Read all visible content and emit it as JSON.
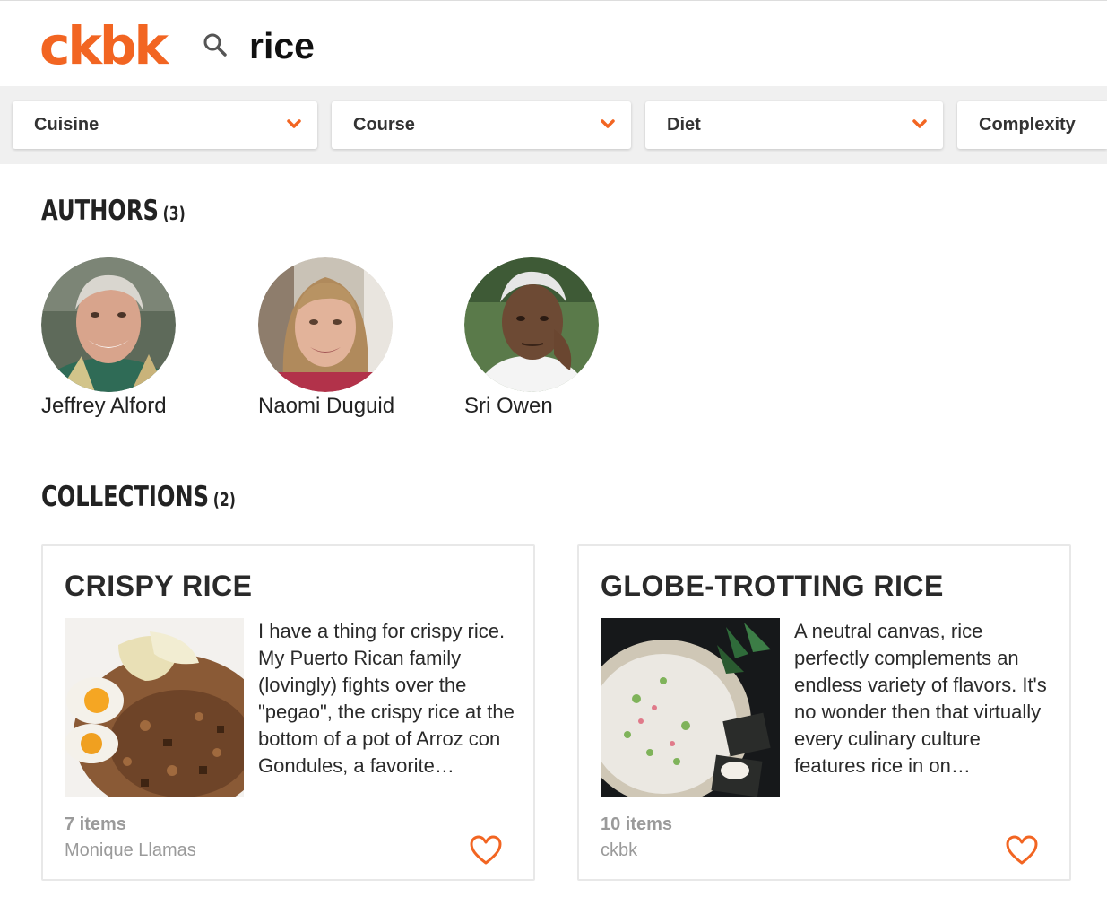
{
  "header": {
    "logo_text": "ckbk",
    "search_icon": "search-icon",
    "search_value": "rice",
    "brand_color": "#f26522"
  },
  "filters": [
    {
      "label": "Cuisine",
      "icon": "chevron-down-icon"
    },
    {
      "label": "Course",
      "icon": "chevron-down-icon"
    },
    {
      "label": "Diet",
      "icon": "chevron-down-icon"
    },
    {
      "label": "Complexity",
      "icon": "chevron-down-icon"
    }
  ],
  "authors": {
    "title": "AUTHORS",
    "count": "(3)",
    "items": [
      {
        "name": "Jeffrey Alford"
      },
      {
        "name": "Naomi Duguid"
      },
      {
        "name": "Sri Owen"
      }
    ]
  },
  "collections": {
    "title": "COLLECTIONS",
    "count": "(2)",
    "items": [
      {
        "title": "CRISPY RICE",
        "description": "I have a thing for crispy rice. My Puerto Rican family (lovingly) fights over the \"pegao\", the crispy rice at the bottom of a pot of Arroz con Gondules, a favorite…",
        "items_count": "7 items",
        "author": "Monique Llamas",
        "favorite_icon": "heart-icon"
      },
      {
        "title": "GLOBE-TROTTING RICE",
        "description": "A neutral canvas, rice perfectly complements an endless variety of flavors. It's no wonder then that virtually every culinary culture features rice in on…",
        "items_count": "10 items",
        "author": "ckbk",
        "favorite_icon": "heart-icon"
      }
    ]
  }
}
